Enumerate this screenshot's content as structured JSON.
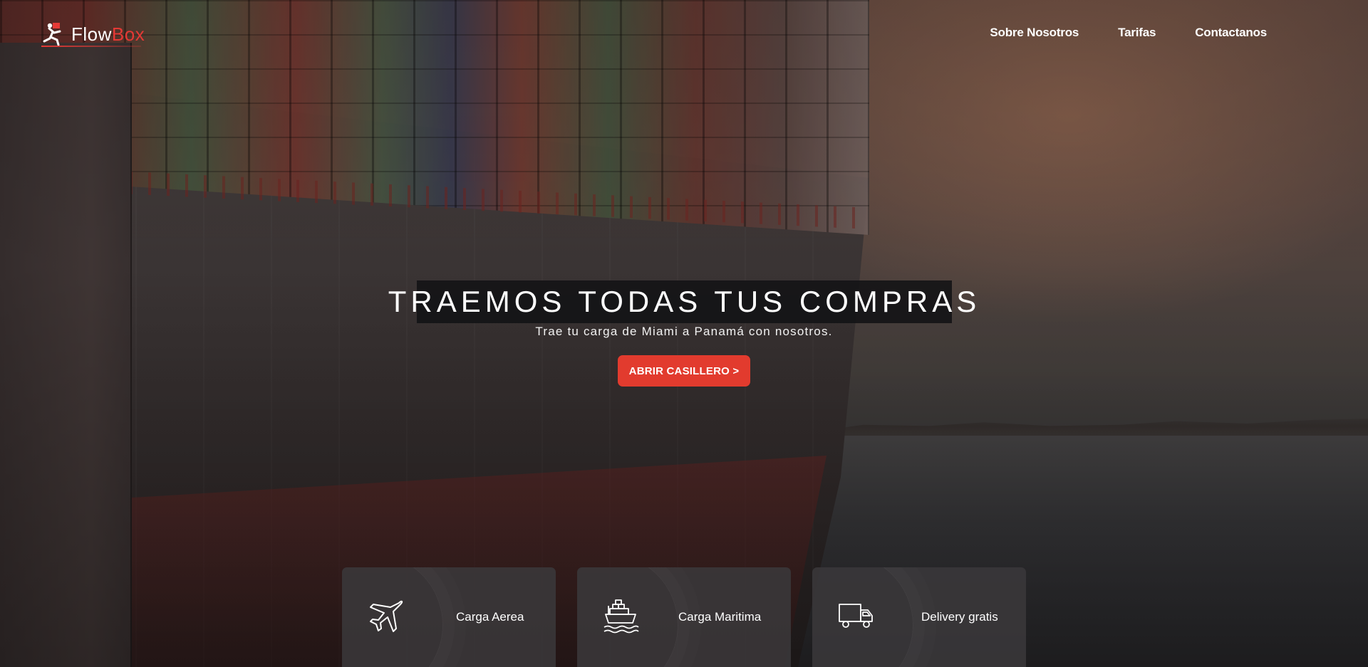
{
  "brand": {
    "logo_text_white": "Flow",
    "logo_text_red": "Box",
    "accent_color": "#e53935"
  },
  "nav": {
    "items": [
      "Sobre Nosotros",
      "Tarifas",
      "Contactanos"
    ]
  },
  "hero": {
    "title": "TRAEMOS TODAS TUS COMPRAS",
    "subtitle": "Trae tu carga de Miami a Panamá con nosotros.",
    "cta_label": "ABRIR CASILLERO >",
    "cta_color": "#e23b2e"
  },
  "services": [
    {
      "icon": "airplane-icon",
      "label": "Carga Aerea"
    },
    {
      "icon": "cargo-ship-icon",
      "label": "Carga Maritima"
    },
    {
      "icon": "delivery-truck-icon",
      "label": "Delivery gratis"
    }
  ]
}
